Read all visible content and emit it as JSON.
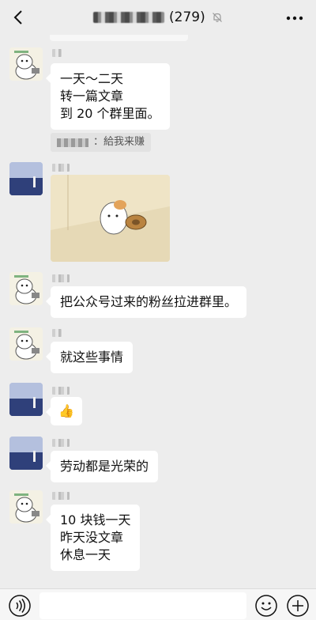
{
  "header": {
    "back_icon": "back-chevron-icon",
    "title_count": "(279)",
    "mute_icon": "mute-bell-icon",
    "more_icon": "more-dots-icon"
  },
  "messages": [
    {
      "avatar": "cartoon-avatar",
      "type": "text",
      "text": "一天～二天\n转一篇文章\n到 20 个群里面。"
    },
    {
      "type": "quote",
      "text": "：給我来赚"
    },
    {
      "avatar": "landscape-avatar",
      "type": "image",
      "image": "hamster-sticker"
    },
    {
      "avatar": "cartoon-avatar",
      "type": "text",
      "text": "把公众号过来的粉丝拉进群里。"
    },
    {
      "avatar": "cartoon-avatar",
      "type": "text",
      "text": "就这些事情"
    },
    {
      "avatar": "landscape-avatar",
      "type": "emoji",
      "text": "👍"
    },
    {
      "avatar": "landscape-avatar",
      "type": "text",
      "text": "劳动都是光荣的"
    },
    {
      "avatar": "cartoon-avatar",
      "type": "text",
      "text": "10 块钱一天\n昨天没文章\n休息一天"
    }
  ],
  "input_bar": {
    "voice_icon": "voice-icon",
    "input_value": "",
    "emoji_icon": "emoji-icon",
    "plus_icon": "plus-icon"
  }
}
